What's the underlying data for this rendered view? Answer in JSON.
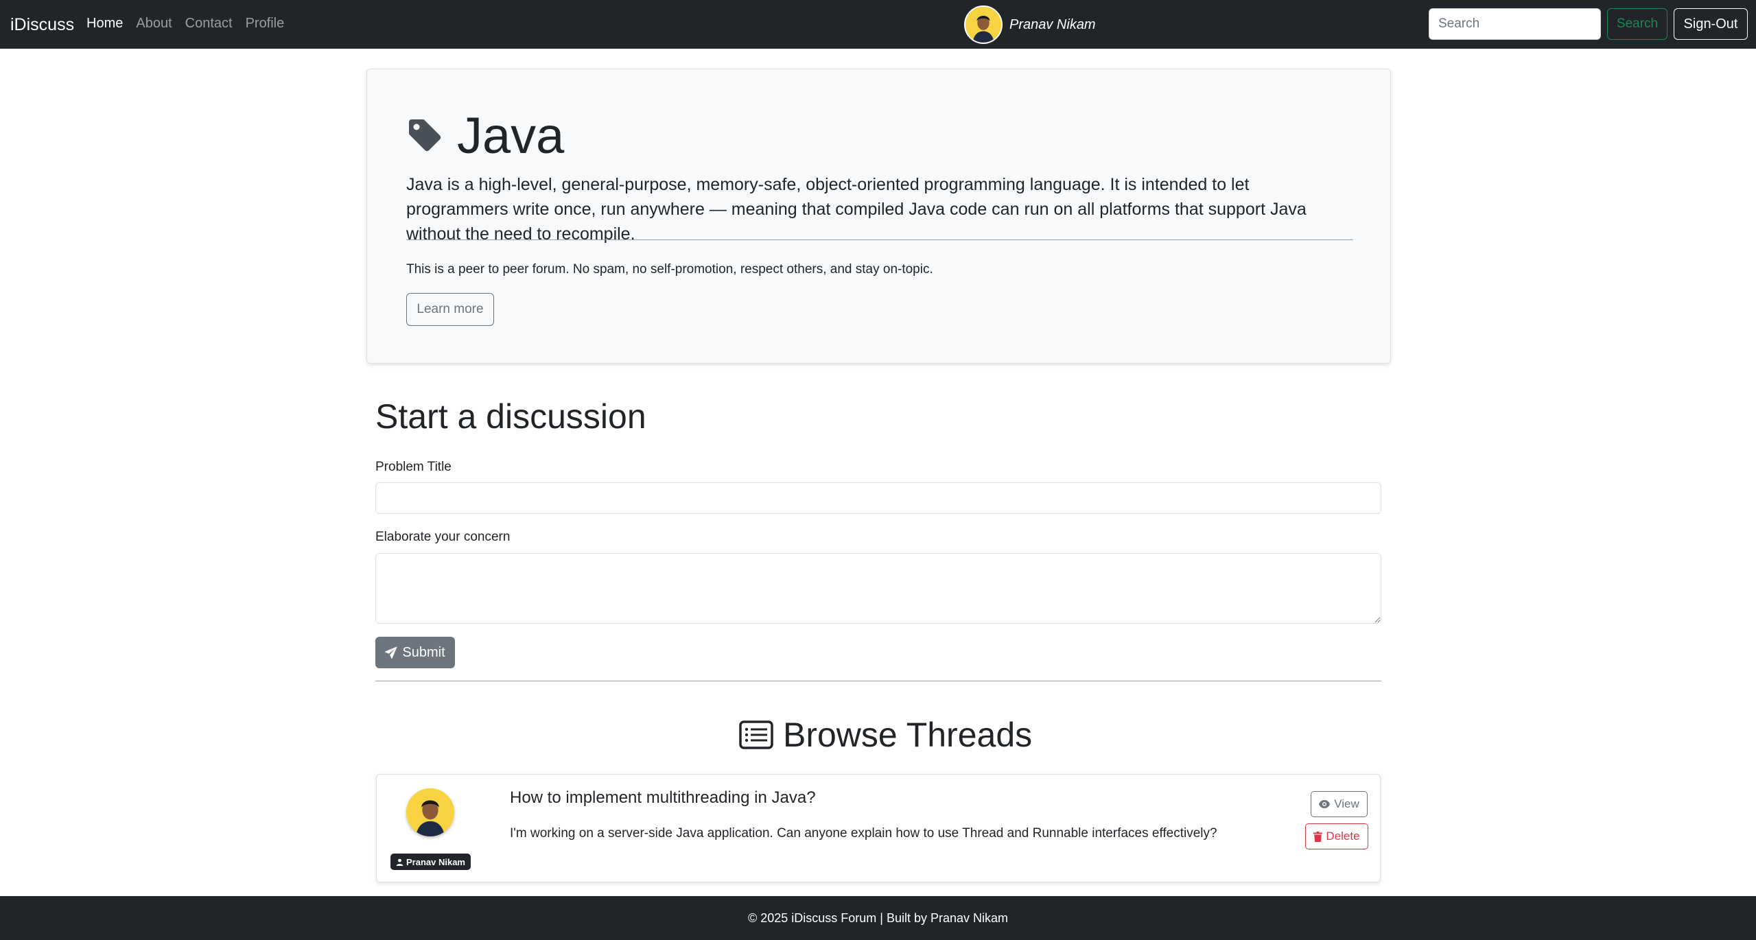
{
  "navbar": {
    "brand": "iDiscuss",
    "links": [
      {
        "label": "Home",
        "active": true
      },
      {
        "label": "About",
        "active": false
      },
      {
        "label": "Contact",
        "active": false
      },
      {
        "label": "Profile",
        "active": false
      }
    ],
    "user": {
      "name": "Pranav Nikam",
      "avatar_icon": "user-avatar"
    },
    "search": {
      "placeholder": "Search",
      "value": "",
      "button_label": "Search"
    },
    "signout_label": "Sign-Out"
  },
  "category": {
    "icon": "tag-icon",
    "title": "Java",
    "description": "Java is a high-level, general-purpose, memory-safe, object-oriented programming language. It is intended to let programmers write once, run anywhere — meaning that compiled Java code can run on all platforms that support Java without the need to recompile.",
    "rules": "This is a peer to peer forum. No spam, no self-promotion, respect others, and stay on-topic.",
    "learn_more_label": "Learn more"
  },
  "discussion_form": {
    "heading": "Start a discussion",
    "title_label": "Problem Title",
    "title_value": "",
    "concern_label": "Elaborate your concern",
    "concern_value": "",
    "submit_label": "Submit",
    "submit_icon": "paper-plane-icon"
  },
  "threads": {
    "heading": "Browse Threads",
    "heading_icon": "list-icon",
    "items": [
      {
        "author": "Pranav Nikam",
        "title": "How to implement multithreading in Java?",
        "body": "I'm working on a server-side Java application. Can anyone explain how to use Thread and Runnable interfaces effectively?",
        "view_label": "View",
        "delete_label": "Delete"
      }
    ]
  },
  "footer": {
    "text": "© 2025 iDiscuss Forum | Built by Pranav Nikam"
  },
  "colors": {
    "navbar_bg": "#212529",
    "success": "#198754",
    "secondary": "#6c757d",
    "danger": "#dc3545",
    "jumbo_bg": "#f8f9fa"
  }
}
